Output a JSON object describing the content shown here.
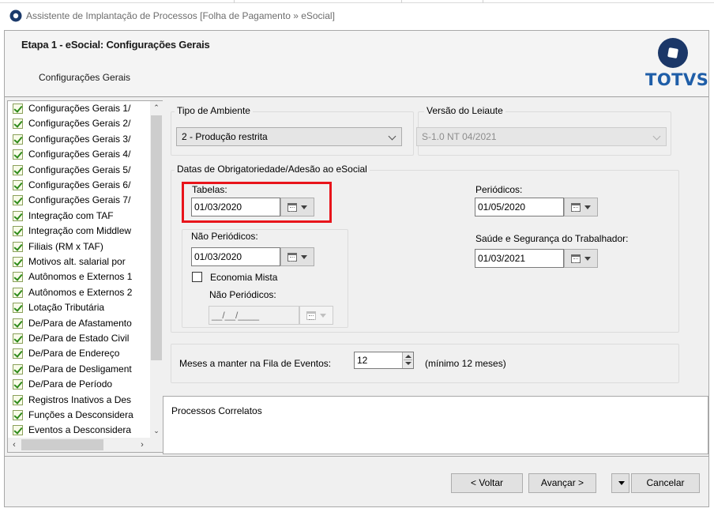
{
  "window": {
    "title": "Assistente de Implantação de Processos [Folha de Pagamento » eSocial]"
  },
  "header": {
    "step_title": "Etapa 1 - eSocial: Configurações Gerais",
    "step_subtitle": "Configurações Gerais",
    "logo_text": "TOTVS"
  },
  "tree": {
    "items": [
      {
        "label": "Configurações Gerais 1/"
      },
      {
        "label": "Configurações Gerais 2/"
      },
      {
        "label": "Configurações Gerais 3/"
      },
      {
        "label": "Configurações Gerais 4/"
      },
      {
        "label": "Configurações Gerais 5/"
      },
      {
        "label": "Configurações Gerais 6/"
      },
      {
        "label": "Configurações Gerais 7/"
      },
      {
        "label": "Integração com TAF"
      },
      {
        "label": "Integração com Middlew"
      },
      {
        "label": "Filiais (RM x TAF)"
      },
      {
        "label": "Motivos alt. salarial por"
      },
      {
        "label": "Autônomos e Externos 1"
      },
      {
        "label": "Autônomos e Externos 2"
      },
      {
        "label": "Lotação Tributária"
      },
      {
        "label": "De/Para de Afastamento"
      },
      {
        "label": "De/Para de Estado Civil"
      },
      {
        "label": "De/Para de Endereço"
      },
      {
        "label": "De/Para de Desligament"
      },
      {
        "label": "De/Para de Período"
      },
      {
        "label": "Registros Inativos a Des"
      },
      {
        "label": "Funções a Desconsidera"
      },
      {
        "label": "Eventos a Desconsidera"
      }
    ]
  },
  "tipo_ambiente": {
    "label": "Tipo de Ambiente",
    "value": "2 - Produção restrita"
  },
  "versao_leiaute": {
    "label": "Versão do Leiaute",
    "value": "S-1.0 NT 04/2021"
  },
  "datas": {
    "label": "Datas de Obrigatoriedade/Adesão ao eSocial",
    "tabelas": {
      "label": "Tabelas:",
      "value": "01/03/2020"
    },
    "nao_periodicos": {
      "label": "Não Periódicos:",
      "value": "01/03/2020"
    },
    "economia_mista": {
      "label": "Economia Mista"
    },
    "nao_periodicos_mista": {
      "label": "Não Periódicos:",
      "value": "__/__/____"
    },
    "periodicos": {
      "label": "Periódicos:",
      "value": "01/05/2020"
    },
    "sst": {
      "label": "Saúde e Segurança do Trabalhador:",
      "value": "01/03/2021"
    }
  },
  "meses": {
    "label": "Meses a manter na Fila de Eventos:",
    "value": "12",
    "hint": "(mínimo 12 meses)"
  },
  "correlatos": {
    "title": "Processos Correlatos"
  },
  "footer": {
    "voltar": "< Voltar",
    "avancar": "Avançar >",
    "cancelar": "Cancelar"
  }
}
